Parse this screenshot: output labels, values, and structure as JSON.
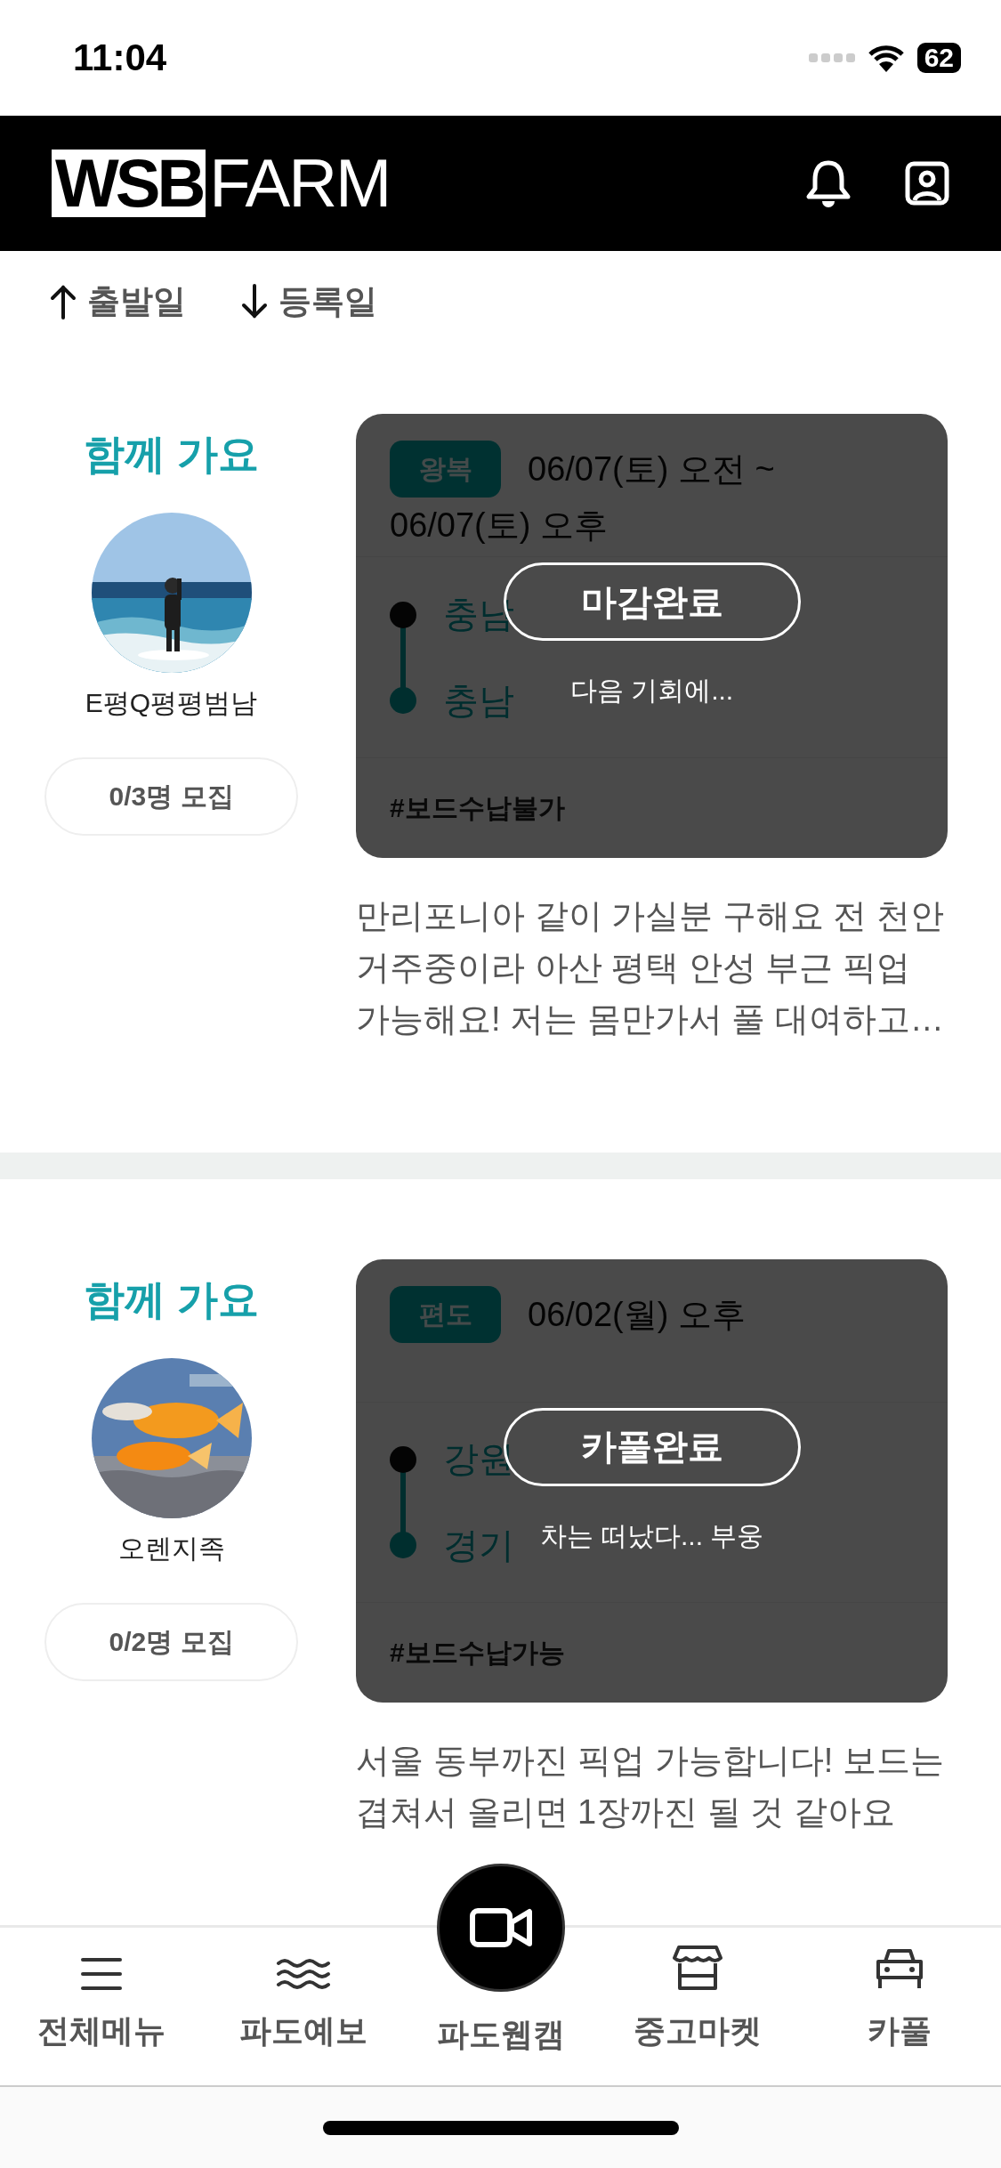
{
  "status_bar": {
    "time": "11:04",
    "battery": "62"
  },
  "header": {
    "logo": {
      "mark": "WSB",
      "word": "FARM"
    }
  },
  "sort_options": [
    {
      "label": "출발일",
      "ascending": true
    },
    {
      "label": "등록일",
      "ascending": false
    }
  ],
  "posts": [
    {
      "heading": "함께 가요",
      "author": "E평Q평평범남",
      "recruit": "0/3명 모집",
      "trip_type": "왕복",
      "schedule": [
        "06/07(토) 오전 ~",
        "06/07(토) 오후"
      ],
      "route": [
        {
          "region": "충남"
        },
        {
          "region": "충남"
        }
      ],
      "tag": "#보드수납불가",
      "status": "마감완료",
      "status_note": "다음 기회에...",
      "description": "만리포니아 같이 가실분 구해요 전 천안 거주중이라 아산 평택 안성 부근 픽업 가능해요! 저는 몸만가서 풀 대여하고…"
    },
    {
      "heading": "함께 가요",
      "author": "오렌지족",
      "recruit": "0/2명 모집",
      "trip_type": "편도",
      "schedule": [
        "06/02(월) 오후"
      ],
      "route": [
        {
          "region": "강원"
        },
        {
          "region": "경기"
        }
      ],
      "tag": "#보드수납가능",
      "status": "카풀완료",
      "status_note": "차는 떠났다... 부웅",
      "description": "서울 동부까진 픽업 가능합니다! 보드는 겹쳐서 올리면 1장까진 될 것 같아요"
    }
  ],
  "bottom_nav": [
    {
      "label": "전체메뉴",
      "kind": "plain"
    },
    {
      "label": "파도예보",
      "kind": "plain"
    },
    {
      "label": "파도웹캠",
      "kind": "raised"
    },
    {
      "label": "중고마켓",
      "kind": "plain"
    },
    {
      "label": "카풀",
      "kind": "plain"
    }
  ]
}
